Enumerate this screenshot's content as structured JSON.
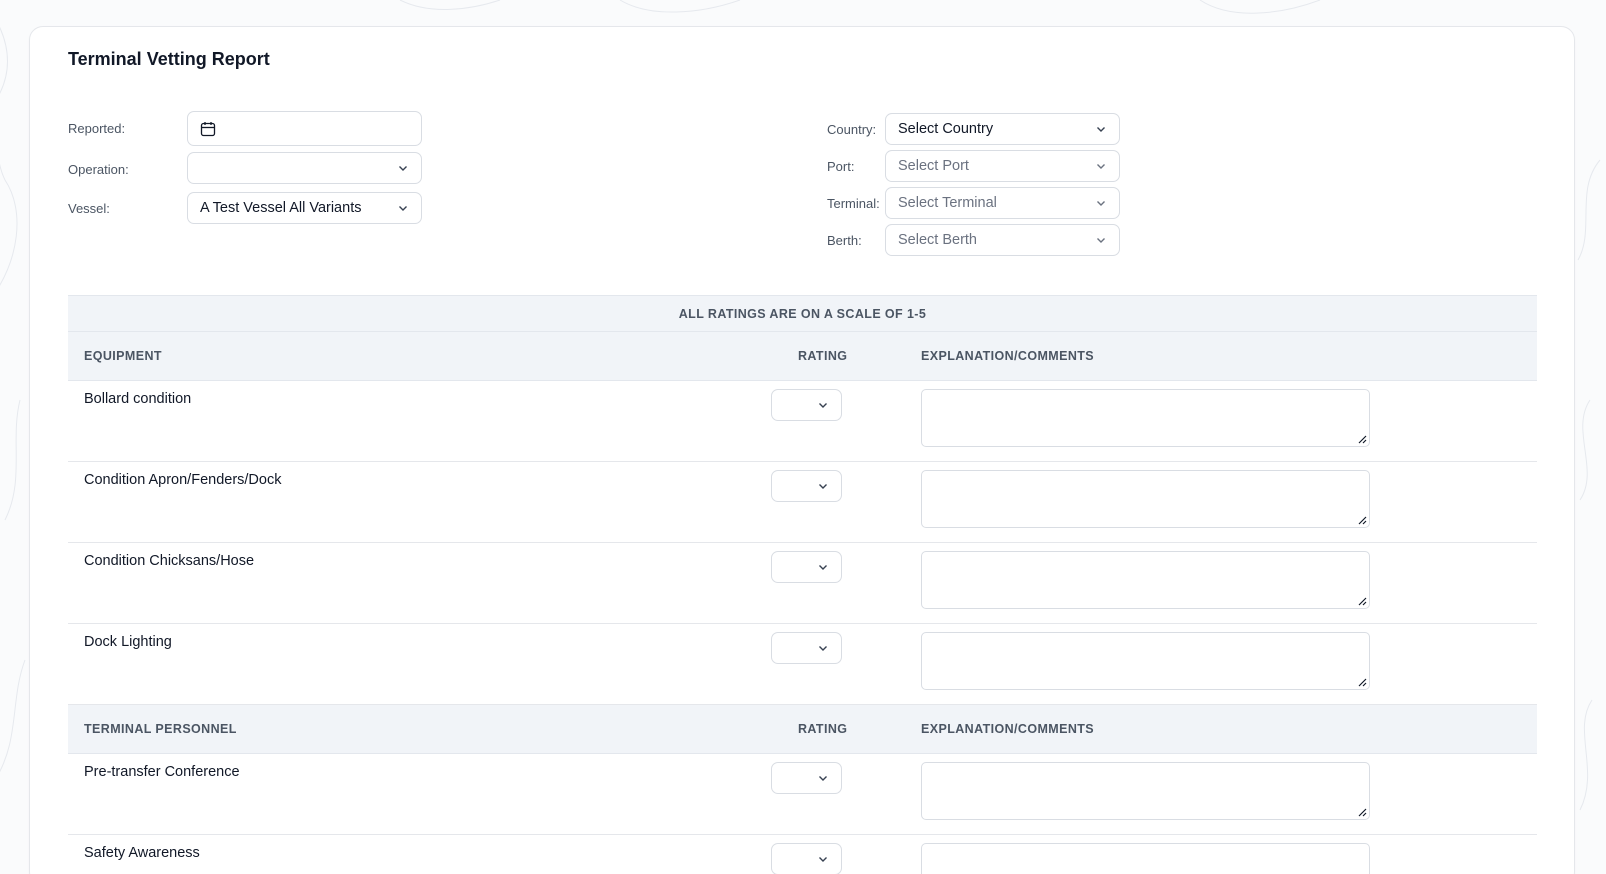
{
  "form": {
    "title": "Terminal Vetting Report",
    "left_fields": [
      {
        "label": "Reported:",
        "value": "",
        "type": "date"
      },
      {
        "label": "Operation:",
        "value": "",
        "type": "select"
      },
      {
        "label": "Vessel:",
        "value": "A Test Vessel All Variants",
        "type": "select"
      }
    ],
    "right_fields": [
      {
        "label": "Country:",
        "value": "Select Country",
        "placeholder": false
      },
      {
        "label": "Port:",
        "value": "Select Port",
        "placeholder": true
      },
      {
        "label": "Terminal:",
        "value": "Select Terminal",
        "placeholder": true
      },
      {
        "label": "Berth:",
        "value": "Select Berth",
        "placeholder": true
      }
    ]
  },
  "ratings": {
    "banner": "ALL RATINGS ARE ON A SCALE OF 1-5",
    "sections": [
      {
        "name": "EQUIPMENT",
        "rating_header": "RATING",
        "comments_header": "EXPLANATION/COMMENTS",
        "items": [
          "Bollard condition",
          "Condition Apron/Fenders/Dock",
          "Condition Chicksans/Hose",
          "Dock Lighting"
        ]
      },
      {
        "name": "TERMINAL PERSONNEL",
        "rating_header": "RATING",
        "comments_header": "EXPLANATION/COMMENTS",
        "items": [
          "Pre-transfer Conference",
          "Safety Awareness"
        ]
      }
    ]
  },
  "colors": {
    "accent_bg": "#f1f4f8",
    "border": "#d9dde3",
    "text": "#111827",
    "muted": "#4b5563"
  }
}
